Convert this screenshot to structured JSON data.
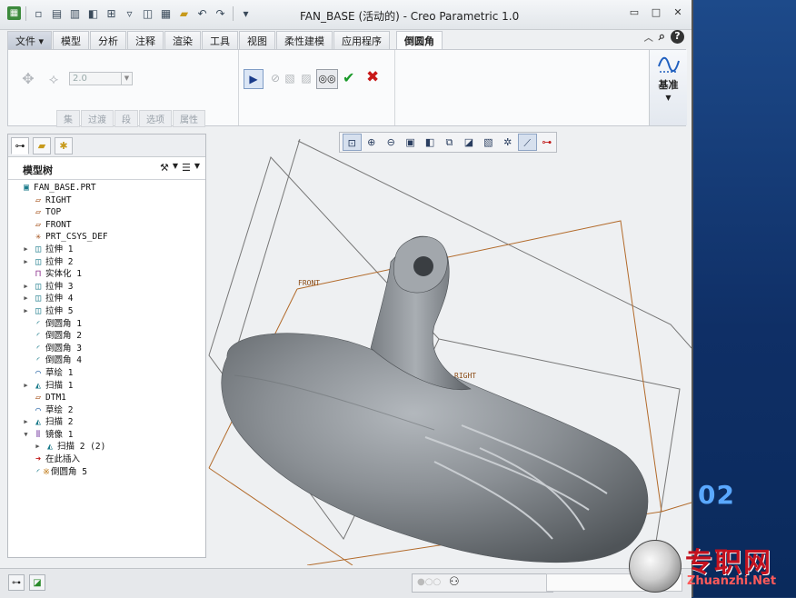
{
  "window": {
    "title": "FAN_BASE (活动的) - Creo Parametric 1.0",
    "controls": [
      "▭",
      "□",
      "✕"
    ]
  },
  "quick_access": [
    "▫",
    "▤",
    "▥",
    "◧",
    "⊞",
    "▿",
    "◫",
    "▦",
    "↶",
    "↷",
    "▾"
  ],
  "tabs": [
    "文件",
    "模型",
    "分析",
    "注释",
    "渲染",
    "工具",
    "视图",
    "柔性建模",
    "应用程序",
    "倒圆角"
  ],
  "active_tab": "倒圆角",
  "ribbon": {
    "radius_value": "2.0",
    "subtabs": [
      "集",
      "过渡",
      "段",
      "选项",
      "属性"
    ],
    "datum_label": "基准"
  },
  "model_tree": {
    "title": "模型树",
    "items": [
      {
        "label": "FAN_BASE.PRT",
        "icon": "part-icon",
        "glyph": "▣",
        "color": "#1a7a8a",
        "indent": 0,
        "expander": ""
      },
      {
        "label": "RIGHT",
        "icon": "datum-plane-icon",
        "glyph": "▱",
        "color": "#a5521c",
        "indent": 1,
        "expander": ""
      },
      {
        "label": "TOP",
        "icon": "datum-plane-icon",
        "glyph": "▱",
        "color": "#a5521c",
        "indent": 1,
        "expander": ""
      },
      {
        "label": "FRONT",
        "icon": "datum-plane-icon",
        "glyph": "▱",
        "color": "#a5521c",
        "indent": 1,
        "expander": ""
      },
      {
        "label": "PRT_CSYS_DEF",
        "icon": "csys-icon",
        "glyph": "✳",
        "color": "#a5521c",
        "indent": 1,
        "expander": ""
      },
      {
        "label": "拉伸 1",
        "icon": "extrude-icon",
        "glyph": "◫",
        "color": "#1a7a8a",
        "indent": 1,
        "expander": "▶"
      },
      {
        "label": "拉伸 2",
        "icon": "extrude-icon",
        "glyph": "◫",
        "color": "#1a7a8a",
        "indent": 1,
        "expander": "▶"
      },
      {
        "label": "实体化 1",
        "icon": "solidify-icon",
        "glyph": "⊓",
        "color": "#8a2a8a",
        "indent": 1,
        "expander": ""
      },
      {
        "label": "拉伸 3",
        "icon": "extrude-icon",
        "glyph": "◫",
        "color": "#1a7a8a",
        "indent": 1,
        "expander": "▶"
      },
      {
        "label": "拉伸 4",
        "icon": "extrude-icon",
        "glyph": "◫",
        "color": "#1a7a8a",
        "indent": 1,
        "expander": "▶"
      },
      {
        "label": "拉伸 5",
        "icon": "extrude-icon",
        "glyph": "◫",
        "color": "#1a7a8a",
        "indent": 1,
        "expander": "▶"
      },
      {
        "label": "倒圆角 1",
        "icon": "round-icon",
        "glyph": "◜",
        "color": "#1a7a8a",
        "indent": 1,
        "expander": ""
      },
      {
        "label": "倒圆角 2",
        "icon": "round-icon",
        "glyph": "◜",
        "color": "#1a7a8a",
        "indent": 1,
        "expander": ""
      },
      {
        "label": "倒圆角 3",
        "icon": "round-icon",
        "glyph": "◜",
        "color": "#1a7a8a",
        "indent": 1,
        "expander": ""
      },
      {
        "label": "倒圆角 4",
        "icon": "round-icon",
        "glyph": "◜",
        "color": "#1a7a8a",
        "indent": 1,
        "expander": ""
      },
      {
        "label": "草绘 1",
        "icon": "sketch-icon",
        "glyph": "⌒",
        "color": "#1a5aa0",
        "indent": 1,
        "expander": ""
      },
      {
        "label": "扫描 1",
        "icon": "sweep-icon",
        "glyph": "◭",
        "color": "#1a7a8a",
        "indent": 1,
        "expander": "▶"
      },
      {
        "label": "DTM1",
        "icon": "datum-plane-icon",
        "glyph": "▱",
        "color": "#a5521c",
        "indent": 1,
        "expander": ""
      },
      {
        "label": "草绘 2",
        "icon": "sketch-icon",
        "glyph": "⌒",
        "color": "#1a5aa0",
        "indent": 1,
        "expander": ""
      },
      {
        "label": "扫描 2",
        "icon": "sweep-icon",
        "glyph": "◭",
        "color": "#1a7a8a",
        "indent": 1,
        "expander": "▶"
      },
      {
        "label": "镜像 1",
        "icon": "mirror-icon",
        "glyph": "⫴",
        "color": "#6a2a9a",
        "indent": 1,
        "expander": "▼"
      },
      {
        "label": "扫描 2 (2)",
        "icon": "sweep-icon",
        "glyph": "◭",
        "color": "#1a7a8a",
        "indent": 2,
        "expander": "▶"
      },
      {
        "label": "在此插入",
        "icon": "insert-here-icon",
        "glyph": "➜",
        "color": "#c01818",
        "indent": 1,
        "expander": ""
      },
      {
        "label": "倒圆角 5",
        "icon": "round-icon",
        "glyph": "◜",
        "color": "#1a7a8a",
        "indent": 1,
        "expander": "",
        "prefix": "※"
      }
    ]
  },
  "viewport": {
    "plane_labels": [
      "FRONT",
      "RIGHT"
    ]
  },
  "desktop": {
    "overlay_number": "02",
    "watermark_cn": "专职网",
    "watermark_en": "Zhuanzhi.Net"
  }
}
